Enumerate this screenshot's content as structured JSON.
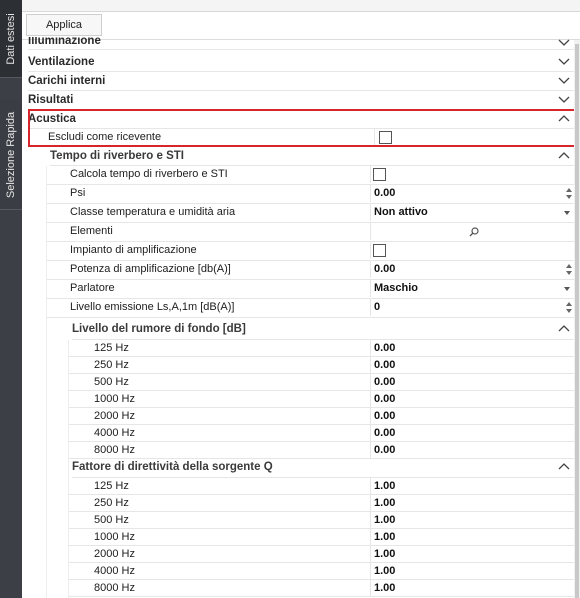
{
  "side_tabs": [
    "Dati estesi",
    "Selezione Rapida"
  ],
  "toolbar": {
    "apply_label": "Applica"
  },
  "categories": [
    {
      "label": "Illuminazione"
    },
    {
      "label": "Ventilazione"
    },
    {
      "label": "Carichi interni"
    },
    {
      "label": "Risultati"
    },
    {
      "label": "Acustica"
    }
  ],
  "acustica": {
    "exclude_label": "Escludi come ricevente",
    "reverb_title": "Tempo di riverbero e STI",
    "props": [
      {
        "label": "Calcola tempo di riverbero e STI",
        "type": "check"
      },
      {
        "label": "Psi",
        "value": "0.00",
        "type": "spin"
      },
      {
        "label": "Classe temperatura e umidità aria",
        "value": "Non attivo",
        "type": "drop"
      },
      {
        "label": "Elementi",
        "type": "search"
      },
      {
        "label": "Impianto di amplificazione",
        "type": "check"
      },
      {
        "label": "Potenza di amplificazione [db(A)]",
        "value": "0.00",
        "type": "spin"
      },
      {
        "label": "Parlatore",
        "value": "Maschio",
        "type": "drop"
      },
      {
        "label": "Livello emissione Ls,A,1m [dB(A)]",
        "value": "0",
        "type": "spin"
      }
    ],
    "noise_title": "Livello del rumore di fondo [dB]",
    "noise": [
      {
        "f": "125 Hz",
        "v": "0.00"
      },
      {
        "f": "250 Hz",
        "v": "0.00"
      },
      {
        "f": "500 Hz",
        "v": "0.00"
      },
      {
        "f": "1000 Hz",
        "v": "0.00"
      },
      {
        "f": "2000 Hz",
        "v": "0.00"
      },
      {
        "f": "4000 Hz",
        "v": "0.00"
      },
      {
        "f": "8000 Hz",
        "v": "0.00"
      }
    ],
    "q_title": "Fattore di direttività della sorgente Q",
    "q": [
      {
        "f": "125 Hz",
        "v": "1.00"
      },
      {
        "f": "250 Hz",
        "v": "1.00"
      },
      {
        "f": "500 Hz",
        "v": "1.00"
      },
      {
        "f": "1000 Hz",
        "v": "1.00"
      },
      {
        "f": "2000 Hz",
        "v": "1.00"
      },
      {
        "f": "4000 Hz",
        "v": "1.00"
      },
      {
        "f": "8000 Hz",
        "v": "1.00"
      }
    ]
  }
}
